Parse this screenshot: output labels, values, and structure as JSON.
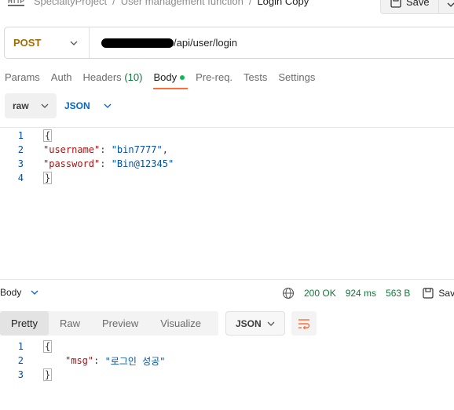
{
  "breadcrumb": {
    "badge": "HTTP",
    "items": [
      "SpecialtyProject",
      "User management function",
      "Login Copy"
    ],
    "separator": "/"
  },
  "toolbar": {
    "save_label": "Save"
  },
  "request": {
    "method": "POST",
    "url_suffix": "/api/user/login"
  },
  "request_tabs": {
    "params": "Params",
    "auth": "Auth",
    "headers": "Headers",
    "headers_count": "(10)",
    "body": "Body",
    "prereq": "Pre-req.",
    "tests": "Tests",
    "settings": "Settings"
  },
  "body_mode": {
    "raw": "raw",
    "format": "JSON"
  },
  "request_body": {
    "line_numbers": [
      "1",
      "2",
      "3",
      "4"
    ],
    "open": "{",
    "close": "}",
    "username_key": "\"username\"",
    "username_value": "\"bin7777\"",
    "password_key": "\"password\"",
    "password_value": "\"Bin@12345\""
  },
  "response": {
    "section_label": "Body",
    "status": "200 OK",
    "time": "924 ms",
    "size": "563 B",
    "save_label": "Sav",
    "tabs": [
      "Pretty",
      "Raw",
      "Preview",
      "Visualize"
    ],
    "format": "JSON",
    "line_numbers": [
      "1",
      "2",
      "3"
    ],
    "open": "{",
    "close": "}",
    "msg_key": "\"msg\"",
    "msg_value": "\"로그인 성공\""
  },
  "colors": {
    "method": "#a36b00",
    "active_tab_underline": "#ff6c37",
    "body_dot": "#0cbb52",
    "status_green": "#0d7a3a",
    "json_blue": "#0265d2",
    "json_key": "#a31515",
    "json_string": "#0451a5",
    "wrap_icon": "#ff6c37"
  }
}
